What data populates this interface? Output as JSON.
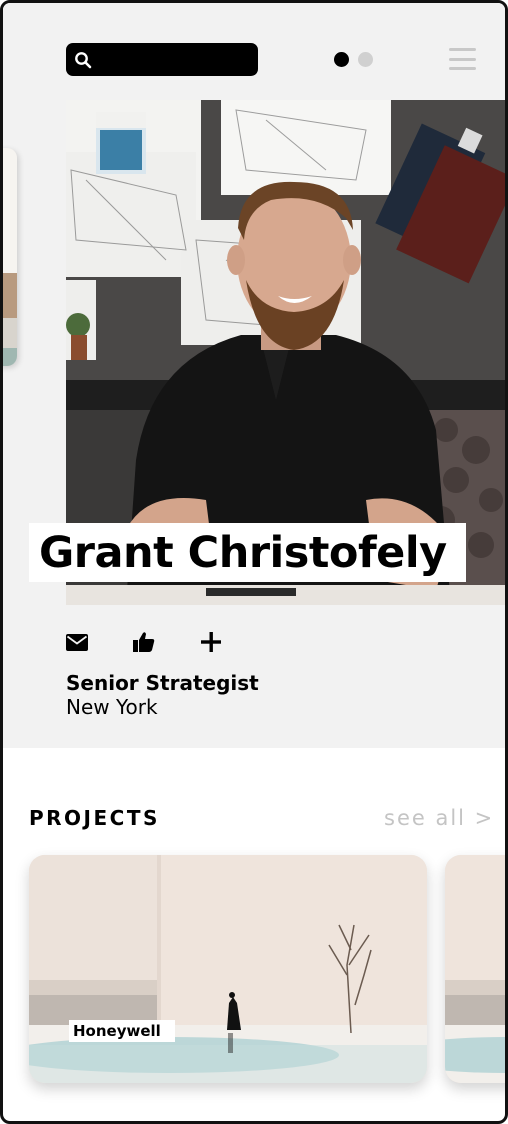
{
  "search": {
    "placeholder": ""
  },
  "carousel": {
    "active_index": 1,
    "total": 2
  },
  "profile": {
    "name": "Grant Christofely",
    "role": "Senior Strategist",
    "location": "New York",
    "photo_alt": "Man with beard smiling at desk"
  },
  "actions": [
    {
      "name": "mail",
      "icon": "mail-icon"
    },
    {
      "name": "like",
      "icon": "thumbs-up-icon"
    },
    {
      "name": "add",
      "icon": "plus-icon"
    }
  ],
  "projects": {
    "title": "PROJECTS",
    "see_all": "see all >",
    "items": [
      {
        "label": "Honeywell"
      }
    ]
  },
  "colors": {
    "background_top": "#f2f2f2",
    "background_bottom": "#ffffff",
    "text": "#000000",
    "muted": "#c4c4c4"
  }
}
